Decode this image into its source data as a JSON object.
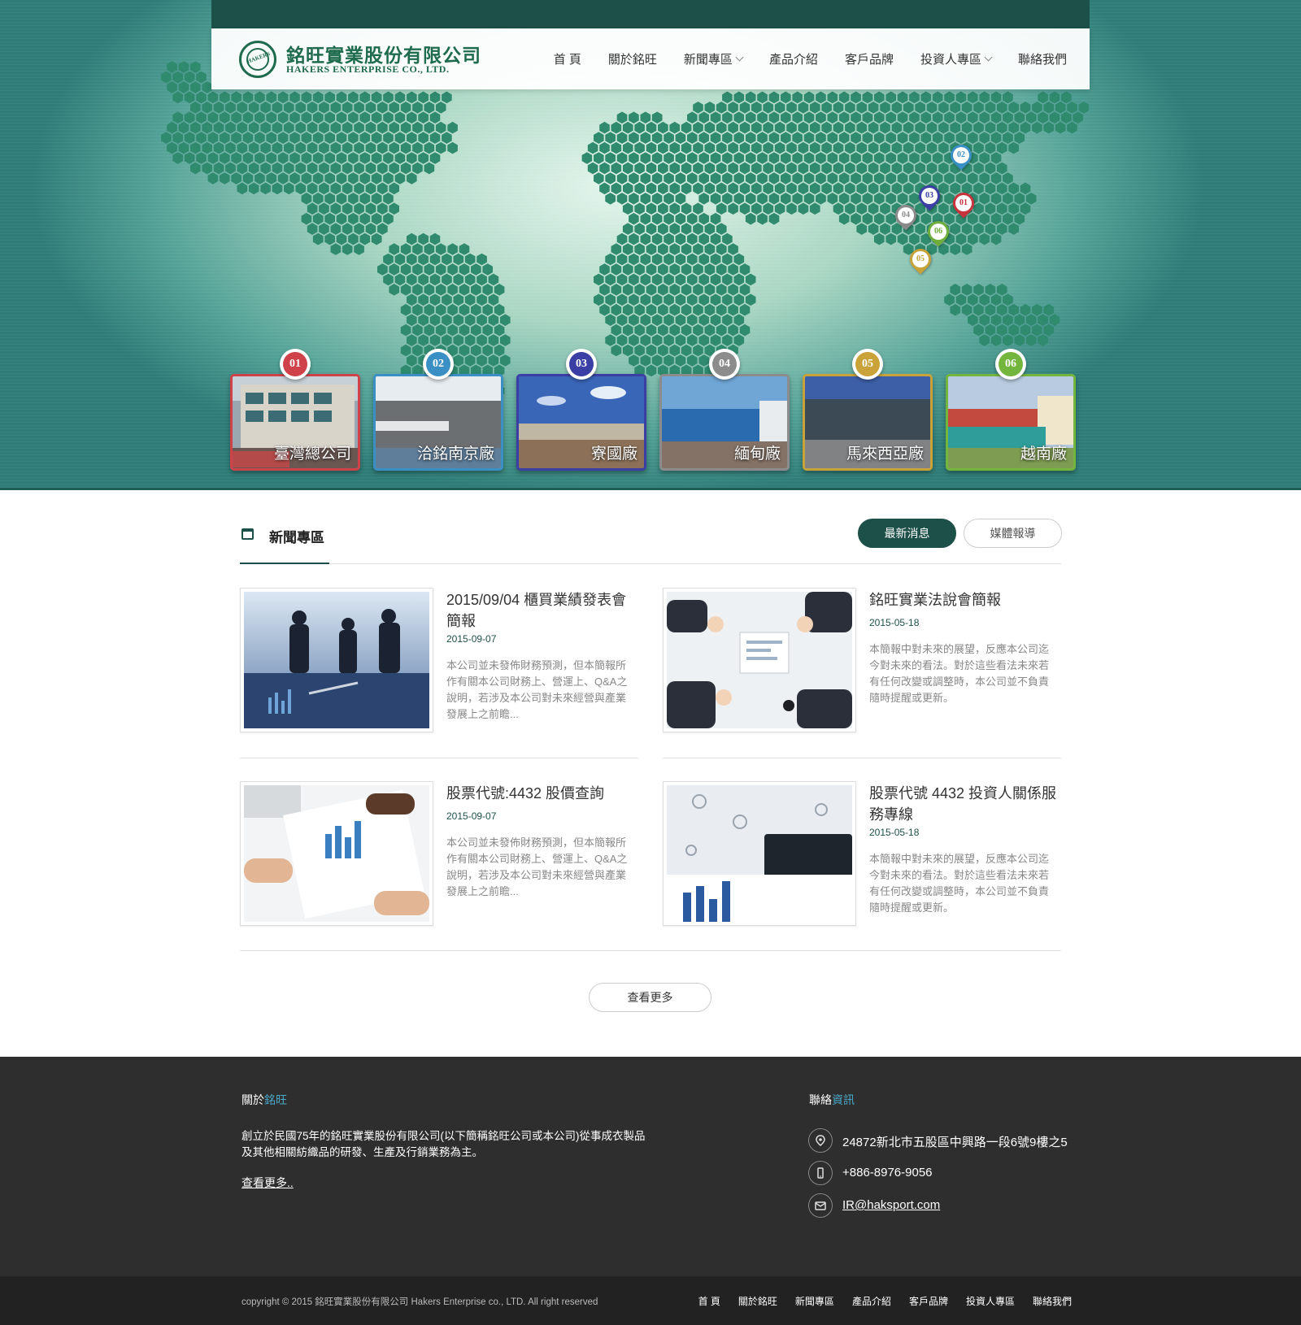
{
  "brand": {
    "logo_mark": "HAKERS",
    "name_cn": "銘旺實業股份有限公司",
    "name_en": "HAKERS ENTERPRISE CO., LTD."
  },
  "nav": {
    "items": [
      {
        "label": "首 頁",
        "has_dropdown": false
      },
      {
        "label": "關於銘旺",
        "has_dropdown": false
      },
      {
        "label": "新聞專區",
        "has_dropdown": true
      },
      {
        "label": "產品介紹",
        "has_dropdown": false
      },
      {
        "label": "客戶品牌",
        "has_dropdown": false
      },
      {
        "label": "投資人專區",
        "has_dropdown": true
      },
      {
        "label": "聯絡我們",
        "has_dropdown": false
      }
    ]
  },
  "map_pins": [
    {
      "num": "02",
      "color": "#3a8fc4"
    },
    {
      "num": "03",
      "color": "#3b3ea5"
    },
    {
      "num": "01",
      "color": "#c8343b"
    },
    {
      "num": "04",
      "color": "#8a8a8a"
    },
    {
      "num": "06",
      "color": "#6fae3a"
    },
    {
      "num": "05",
      "color": "#c6a33a"
    }
  ],
  "factories": [
    {
      "num": "01",
      "label": "臺灣總公司",
      "color": "#d0424a"
    },
    {
      "num": "02",
      "label": "洽銘南京廠",
      "color": "#3a8fc4"
    },
    {
      "num": "03",
      "label": "寮國廠",
      "color": "#3b3ea5"
    },
    {
      "num": "04",
      "label": "緬甸廠",
      "color": "#8c8c8c"
    },
    {
      "num": "05",
      "label": "馬來西亞廠",
      "color": "#c9a23a"
    },
    {
      "num": "06",
      "label": "越南廠",
      "color": "#74b53d"
    }
  ],
  "news": {
    "title": "新聞專區",
    "tabs": [
      "最新消息",
      "媒體報導"
    ],
    "articles": [
      {
        "title": "2015/09/04 櫃買業績發表會簡報",
        "date": "2015-09-07",
        "excerpt": "本公司並未發佈財務預測，但本簡報所作有關本公司財務上、營運上、Q&A之說明，若涉及本公司對未來經營與產業發展上之前瞻..."
      },
      {
        "title": "銘旺實業法說會簡報",
        "date": "2015-05-18",
        "excerpt": "本簡報中對未來的展望，反應本公司迄今對未來的看法。對於這些看法未來若有任何改變或調整時，本公司並不負責隨時提醒或更新。"
      },
      {
        "title": "股票代號:4432 股價查詢",
        "date": "2015-09-07",
        "excerpt": "本公司並未發佈財務預測，但本簡報所作有關本公司財務上、營運上、Q&A之說明，若涉及本公司對未來經營與產業發展上之前瞻..."
      },
      {
        "title": "股票代號 4432 投資人關係服務專線",
        "date": "2015-05-18",
        "excerpt": "本簡報中對未來的展望，反應本公司迄今對未來的看法。對於這些看法未來若有任何改變或調整時，本公司並不負責隨時提醒或更新。"
      }
    ],
    "more_label": "查看更多"
  },
  "footer": {
    "about_title_a": "關於",
    "about_title_b": "銘旺",
    "about_text": "創立於民國75年的銘旺實業股份有限公司(以下簡稱銘旺公司或本公司)從事成衣製品及其他相關紡織品的研發、生產及行銷業務為主。",
    "about_more": "查看更多",
    "about_more_suffix": "..",
    "contact_title_a": "聯絡",
    "contact_title_b": "資訊",
    "address": "24872新北市五股區中興路一段6號9樓之5",
    "phone": "+886-8976-9056",
    "email": "IR@haksport.com",
    "copyright": "copyright © 2015 銘旺實業股份有限公司 Hakers Enterprise co., LTD. All right reserved",
    "links": [
      "首 頁",
      "關於銘旺",
      "新聞專區",
      "產品介紹",
      "客戶品牌",
      "投資人專區",
      "聯絡我們"
    ]
  },
  "colors": {
    "brand_green": "#1d5048",
    "logo_green": "#1f6b4e",
    "map_hex": "#2f8a6e",
    "accent_blue": "#4aa8c8"
  }
}
